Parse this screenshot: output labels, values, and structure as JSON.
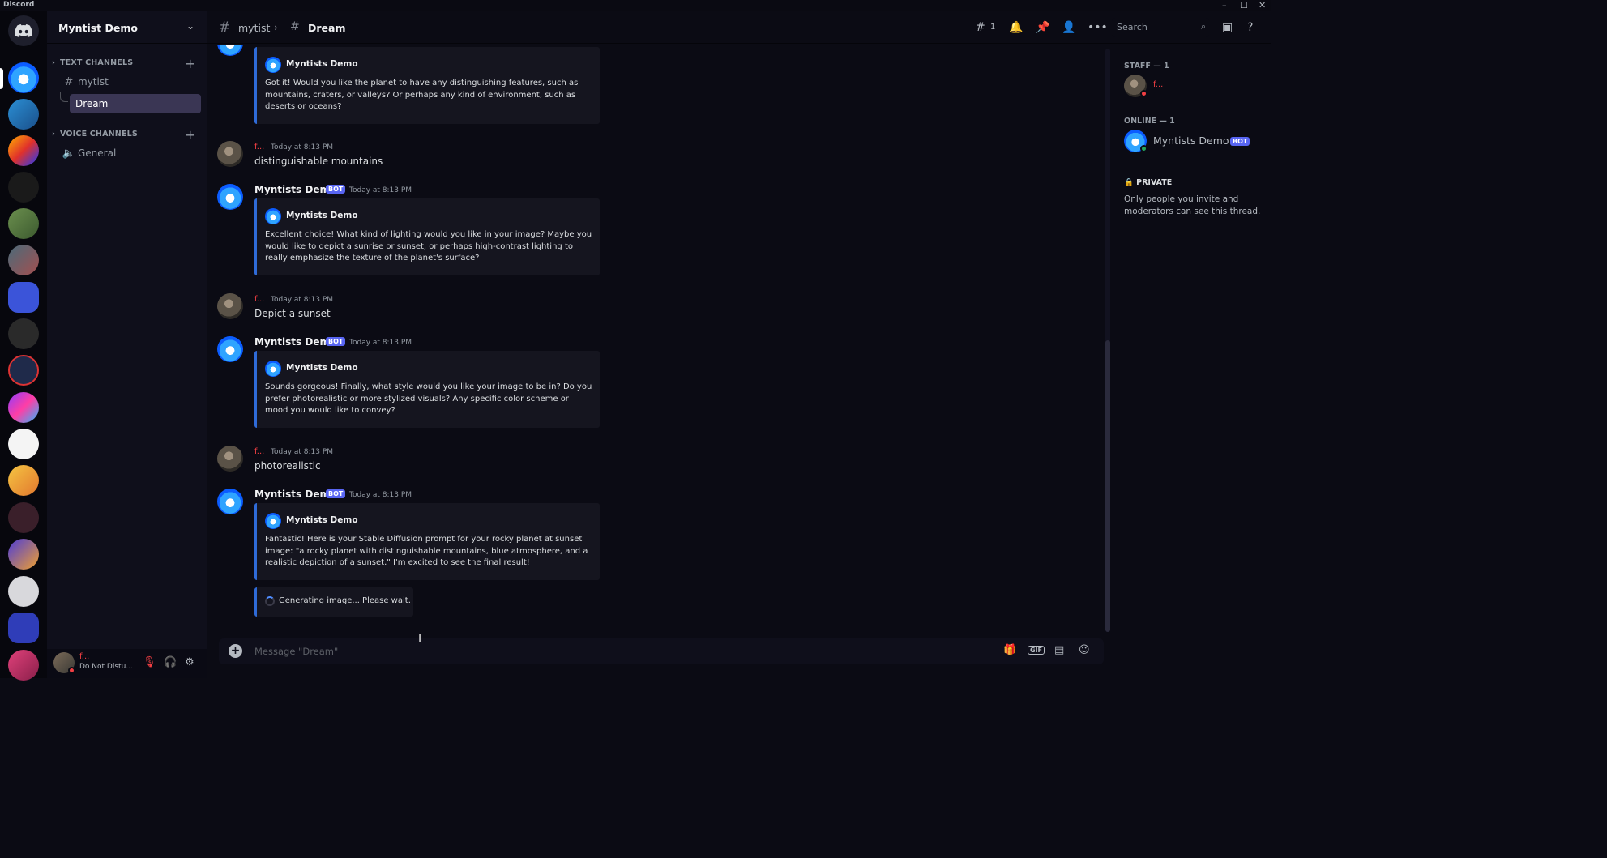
{
  "titlebar": {
    "app_name": "Discord"
  },
  "window_controls": {
    "minimize": "–",
    "maximize": "☐",
    "close": "✕"
  },
  "server": {
    "name": "Myntist Demo"
  },
  "channels": {
    "text_category": "TEXT CHANNELS",
    "voice_category": "VOICE CHANNELS",
    "text_channel": "mytist",
    "thread": "Dream",
    "voice_channel": "General"
  },
  "user_panel": {
    "username": "f...",
    "status": "Do Not Distu..."
  },
  "header": {
    "parent_channel": "mytist",
    "thread_title": "Dream",
    "threads_count": "1",
    "search_placeholder": "Search"
  },
  "messages": [
    {
      "type": "bot-cont",
      "embed_author": "Myntists Demo",
      "embed_text": "Got it! Would you like the planet to have any distinguishing features, such as mountains, craters, or valleys? Or perhaps any kind of environment, such as deserts or oceans?"
    },
    {
      "type": "user",
      "author": "f...",
      "time": "Today at 8:13 PM",
      "text": "distinguishable mountains"
    },
    {
      "type": "bot",
      "author": "Myntists Demo",
      "badge": "BOT",
      "time": "Today at 8:13 PM",
      "embed_author": "Myntists Demo",
      "embed_text": "Excellent choice! What kind of lighting would you like in your image? Maybe you would like to depict a sunrise or sunset, or perhaps high-contrast lighting to really emphasize the texture of the planet's surface?"
    },
    {
      "type": "user",
      "author": "f...",
      "time": "Today at 8:13 PM",
      "text": "Depict a sunset"
    },
    {
      "type": "bot",
      "author": "Myntists Demo",
      "badge": "BOT",
      "time": "Today at 8:13 PM",
      "embed_author": "Myntists Demo",
      "embed_text": "Sounds gorgeous! Finally, what style would you like your image to be in? Do you prefer photorealistic or more stylized visuals? Any specific color scheme or mood you would like to convey?"
    },
    {
      "type": "user",
      "author": "f...",
      "time": "Today at 8:13 PM",
      "text": "photorealistic"
    },
    {
      "type": "bot",
      "author": "Myntists Demo",
      "badge": "BOT",
      "time": "Today at 8:13 PM",
      "embed_author": "Myntists Demo",
      "embed_text": "Fantastic! Here is your Stable Diffusion prompt for your rocky planet at sunset image: \"a rocky planet with distinguishable mountains, blue atmosphere, and a realistic depiction of a sunset.\" I'm excited to see the final result!"
    }
  ],
  "generating": "Generating image... Please wait.",
  "composer": {
    "placeholder": "Message \"Dream\"",
    "gif_label": "GIF"
  },
  "members": {
    "staff_header": "STAFF — 1",
    "staff_name": "f...",
    "online_header": "ONLINE — 1",
    "online_name": "Myntists Demo",
    "online_badge": "BOT",
    "private_label": "PRIVATE",
    "private_text": "Only people you invite and moderators can see this thread."
  },
  "colors": {
    "accent": "#5865f2",
    "dnd": "#f23f43",
    "online": "#23a55a",
    "embed_border": "#2f6bd8",
    "selected": "#3a3654"
  }
}
